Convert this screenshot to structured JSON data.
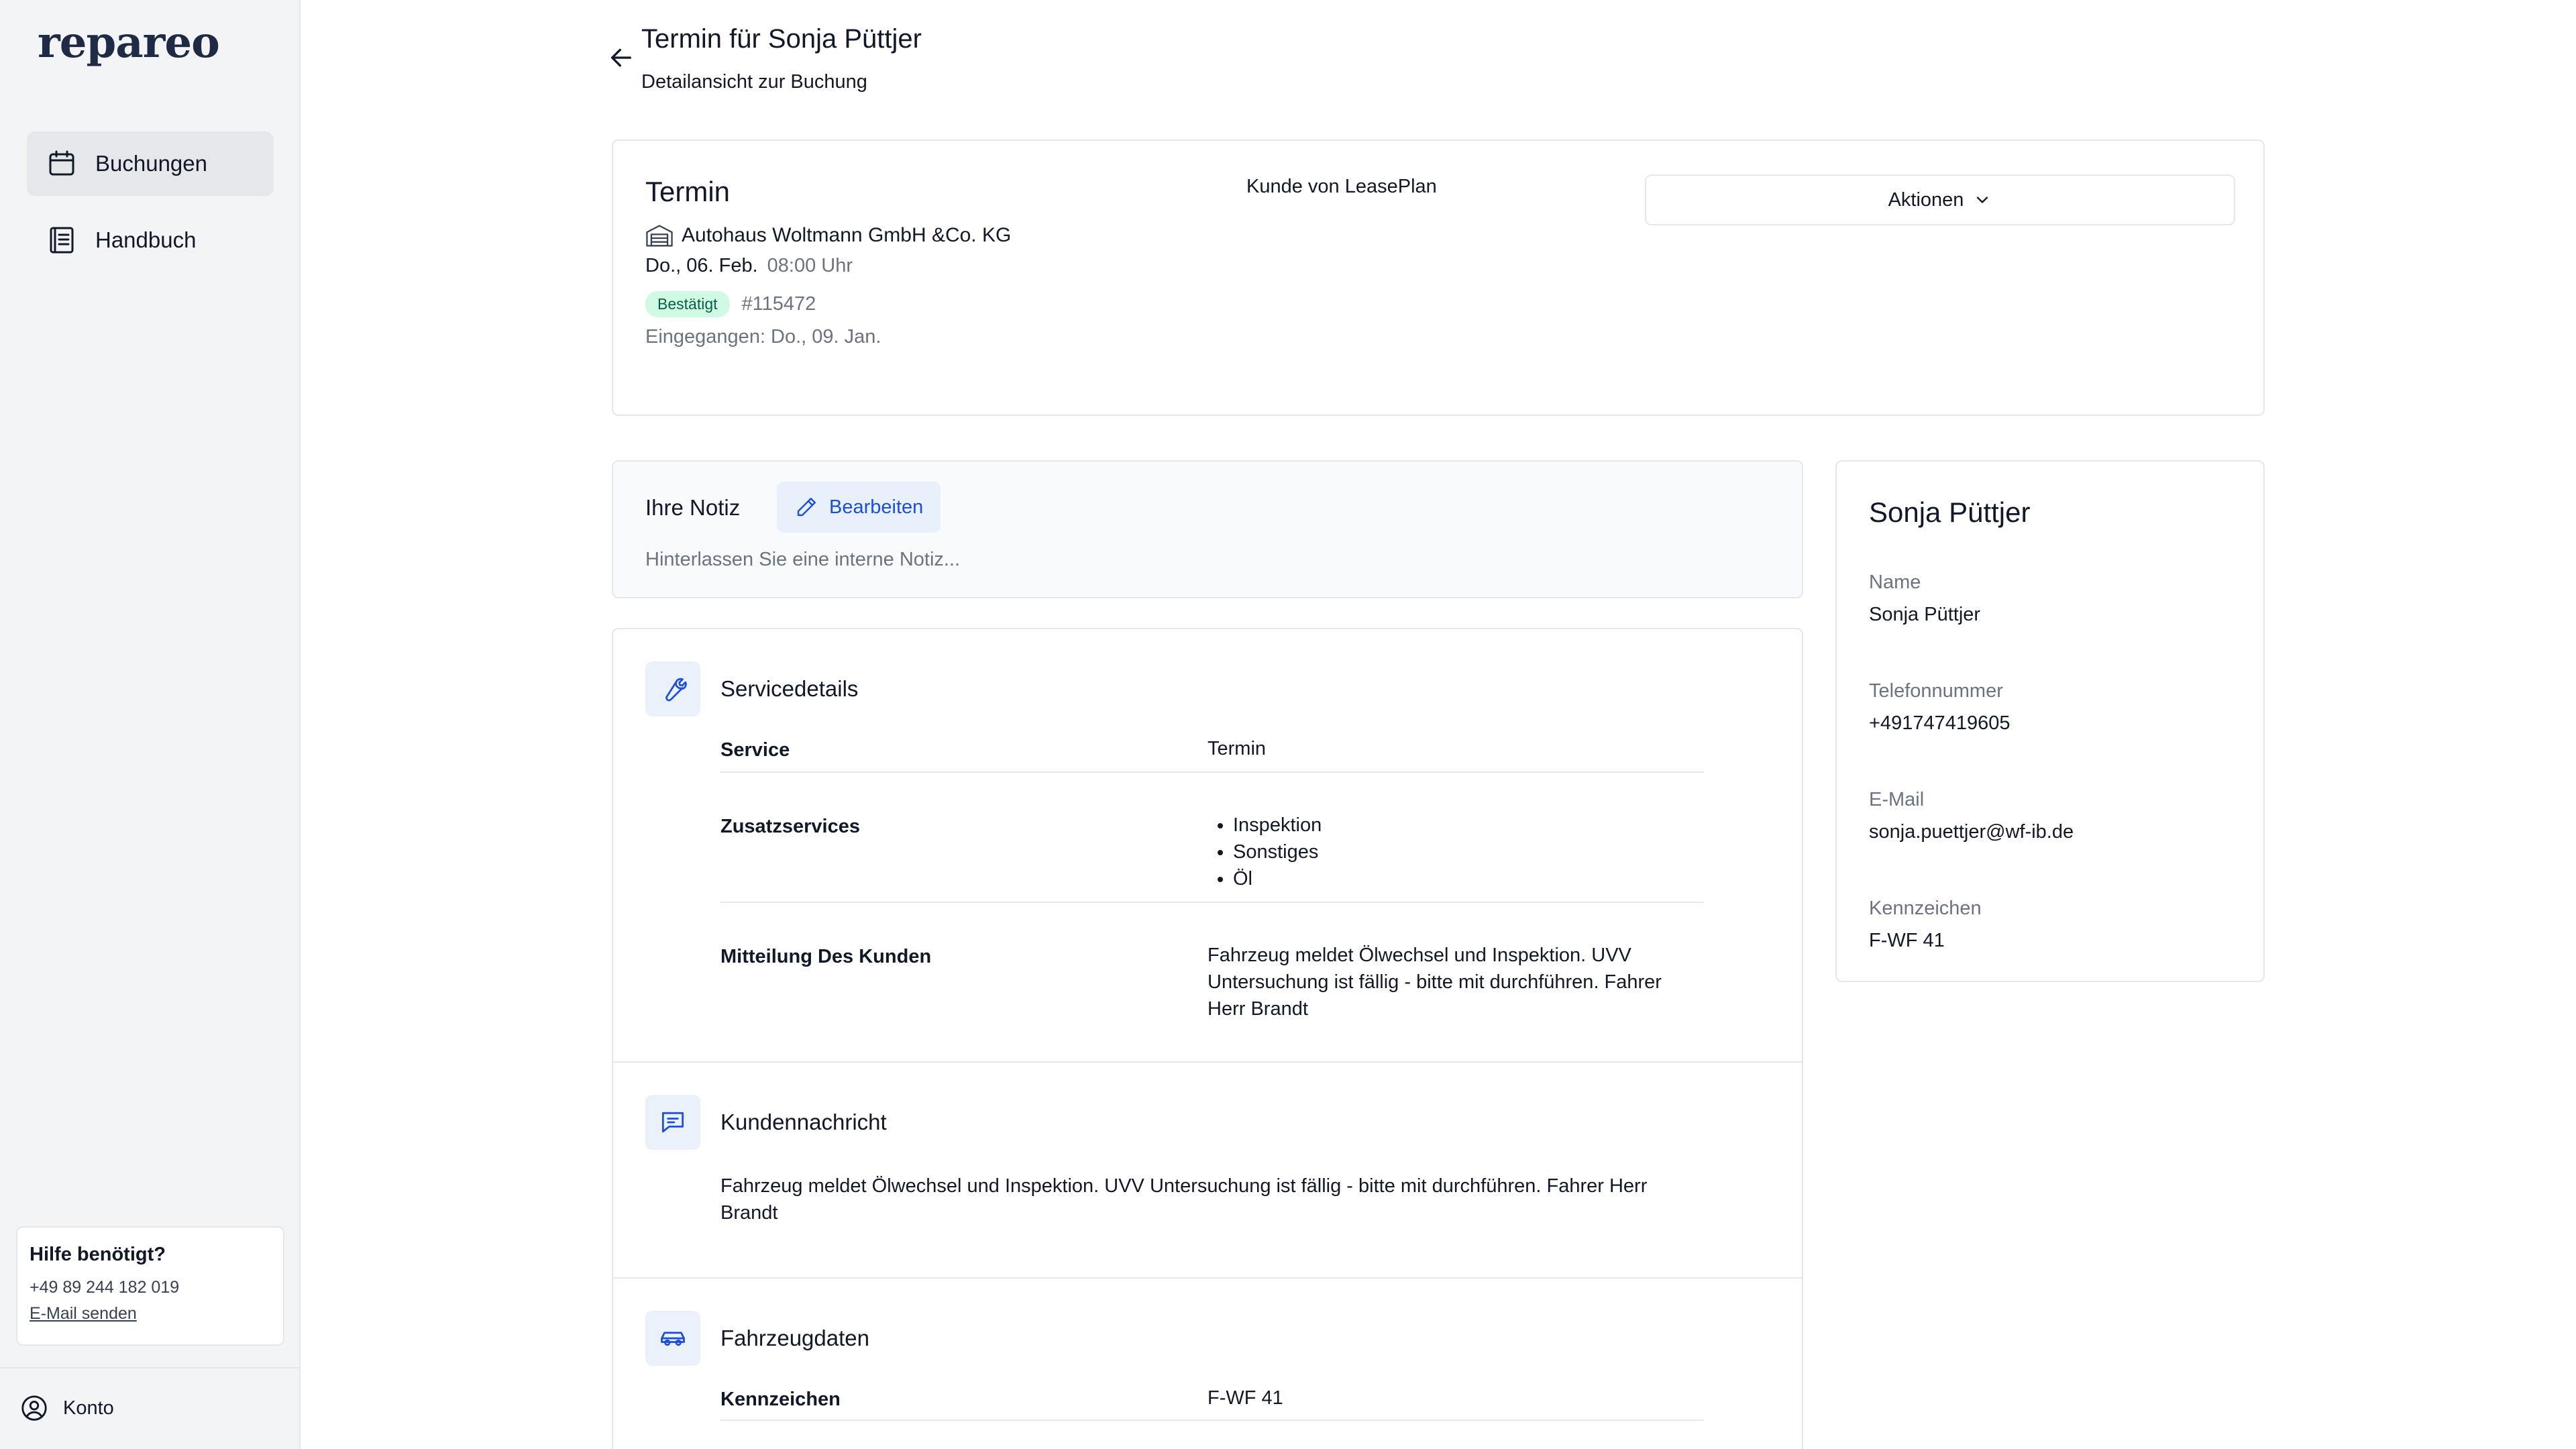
{
  "sidebar": {
    "logo": "repareo",
    "nav": [
      {
        "label": "Buchungen",
        "icon": "calendar-icon",
        "active": true
      },
      {
        "label": "Handbuch",
        "icon": "book-icon",
        "active": false
      }
    ],
    "help": {
      "title": "Hilfe benötigt?",
      "phone": "+49 89 244 182 019",
      "mail_label": "E-Mail senden"
    },
    "account_label": "Konto"
  },
  "header": {
    "title": "Termin für Sonja Püttjer",
    "subtitle": "Detailansicht zur Buchung"
  },
  "appointment": {
    "heading": "Termin",
    "workshop": "Autohaus Woltmann GmbH &Co. KG",
    "date": "Do., 06. Feb.",
    "time": "08:00 Uhr",
    "status": "Bestätigt",
    "booking_id": "#115472",
    "received": "Eingegangen: Do., 09. Jan.",
    "customer_of": "Kunde von LeasePlan",
    "actions_label": "Aktionen"
  },
  "note": {
    "title": "Ihre Notiz",
    "edit_label": "Bearbeiten",
    "placeholder": "Hinterlassen Sie eine interne Notiz..."
  },
  "service": {
    "title": "Servicedetails",
    "rows": [
      {
        "label": "Service",
        "value": "Termin"
      },
      {
        "label": "Zusatzservices",
        "values": [
          "Inspektion",
          "Sonstiges",
          "Öl"
        ]
      },
      {
        "label": "Mitteilung Des Kunden",
        "value": "Fahrzeug meldet Ölwechsel und Inspektion. UVV Untersuchung ist fällig - bitte mit durchführen. Fahrer Herr Brandt"
      }
    ]
  },
  "customer_message": {
    "title": "Kundennachricht",
    "text": "Fahrzeug meldet Ölwechsel und Inspektion. UVV Untersuchung ist fällig - bitte mit durchführen. Fahrer Herr Brandt"
  },
  "vehicle": {
    "title": "Fahrzeugdaten",
    "rows": [
      {
        "label": "Kennzeichen",
        "value": "F-WF 41"
      }
    ]
  },
  "customer": {
    "name": "Sonja Püttjer",
    "fields": [
      {
        "label": "Name",
        "value": "Sonja Püttjer"
      },
      {
        "label": "Telefonnummer",
        "value": "+491747419605"
      },
      {
        "label": "E-Mail",
        "value": "sonja.puettjer@wf-ib.de"
      },
      {
        "label": "Kennzeichen",
        "value": "F-WF 41"
      }
    ]
  },
  "colors": {
    "sidebar_bg": "#f3f4f6",
    "accent_blue": "#1d4ed8",
    "badge_bg": "#d1fae5",
    "badge_text": "#065f46"
  }
}
